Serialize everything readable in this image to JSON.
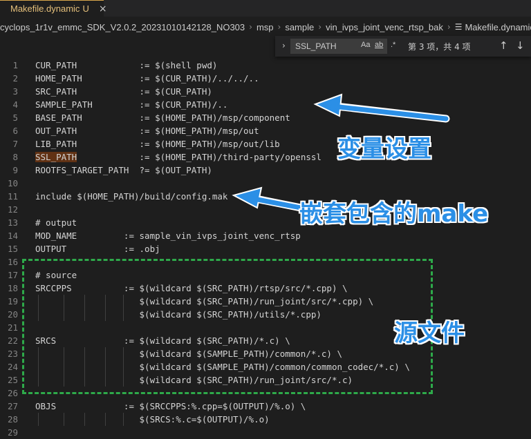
{
  "tab": {
    "name": "Makefile.dynamic",
    "badge": "U",
    "close": "×"
  },
  "breadcrumbs": [
    "cyclops_1r1v_emmc_SDK_V2.0.2_20231010142128_NO303",
    "msp",
    "sample",
    "vin_ivps_joint_venc_rtsp_bak",
    "Makefile.dynamic"
  ],
  "find": {
    "query": "SSL_PATH",
    "opt_case": "Aa",
    "opt_word": "ab",
    "opt_regex": ".*",
    "result": "第 3 项，共 4 项",
    "prev": "↑",
    "next": "↓",
    "expand": "›"
  },
  "lines": [
    {
      "n": "1",
      "pre": "CUR_PATH            := $(shell pwd)"
    },
    {
      "n": "2",
      "pre": "HOME_PATH           := $(CUR_PATH)/../../.."
    },
    {
      "n": "3",
      "pre": "SRC_PATH            := $(CUR_PATH)"
    },
    {
      "n": "4",
      "pre": "SAMPLE_PATH         := $(CUR_PATH)/.."
    },
    {
      "n": "5",
      "pre": "BASE_PATH           := $(HOME_PATH)/msp/component"
    },
    {
      "n": "6",
      "pre": "OUT_PATH            := $(HOME_PATH)/msp/out"
    },
    {
      "n": "7",
      "pre": "LIB_PATH            := $(HOME_PATH)/msp/out/lib"
    },
    {
      "n": "8",
      "hl": "SSL_PATH",
      "post": "            := $(HOME_PATH)/third-party/openssl"
    },
    {
      "n": "9",
      "pre": "ROOTFS_TARGET_PATH  ?= $(OUT_PATH)"
    },
    {
      "n": "10",
      "pre": ""
    },
    {
      "n": "11",
      "pre": "include $(HOME_PATH)/build/config.mak"
    },
    {
      "n": "12",
      "pre": ""
    },
    {
      "n": "13",
      "pre": "# output"
    },
    {
      "n": "14",
      "pre": "MOD_NAME         := sample_vin_ivps_joint_venc_rtsp"
    },
    {
      "n": "15",
      "pre": "OUTPUT           := .obj"
    },
    {
      "n": "16",
      "pre": ""
    },
    {
      "n": "17",
      "pre": "# source"
    },
    {
      "n": "18",
      "pre": "SRCCPPS          := $(wildcard $(SRC_PATH)/rtsp/src/*.cpp) \\"
    },
    {
      "n": "19",
      "pre": "                    $(wildcard $(SRC_PATH)/run_joint/src/*.cpp) \\"
    },
    {
      "n": "20",
      "pre": "                    $(wildcard $(SRC_PATH)/utils/*.cpp)"
    },
    {
      "n": "21",
      "pre": ""
    },
    {
      "n": "22",
      "pre": "SRCS             := $(wildcard $(SRC_PATH)/*.c) \\"
    },
    {
      "n": "23",
      "pre": "                    $(wildcard $(SAMPLE_PATH)/common/*.c) \\"
    },
    {
      "n": "24",
      "pre": "                    $(wildcard $(SAMPLE_PATH)/common/common_codec/*.c) \\"
    },
    {
      "n": "25",
      "pre": "                    $(wildcard $(SRC_PATH)/run_joint/src/*.c)"
    },
    {
      "n": "26",
      "pre": ""
    },
    {
      "n": "27",
      "pre": "OBJS             := $(SRCCPPS:%.cpp=$(OUTPUT)/%.o) \\"
    },
    {
      "n": "28",
      "pre": "                    $(SRCS:%.c=$(OUTPUT)/%.o)"
    },
    {
      "n": "29",
      "pre": ""
    }
  ],
  "annotations": {
    "variables": "变量设置",
    "nested": "嵌套包含的make",
    "sources": "源文件"
  },
  "colors": {
    "annotation": "#2b8fe6",
    "dash_box": "#2eaa4a",
    "match_highlight": "#613214"
  }
}
